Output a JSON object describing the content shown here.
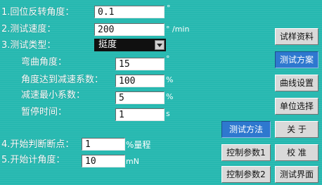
{
  "params": {
    "reverse_angle": {
      "label": "1.回位反转角度：",
      "value": "0.1",
      "unit": "°"
    },
    "test_speed": {
      "label": "2.测试速度：",
      "value": "200",
      "unit": "° /min"
    },
    "test_type": {
      "label": "3.测试类型：",
      "value": "挺度"
    },
    "bend_angle": {
      "label": "弯曲角度：",
      "value": "15",
      "unit": "°"
    },
    "angle_decel_coef": {
      "label": "角度达到减速系数：",
      "value": "100",
      "unit": "%"
    },
    "decel_min_coef": {
      "label": "减速最小系数：",
      "value": "5",
      "unit": "%"
    },
    "pause_time": {
      "label": "暂停时间：",
      "value": "1",
      "unit": "s"
    },
    "break_point": {
      "label": "4.开始判断断点：",
      "value": "1",
      "unit": "%量程"
    },
    "start_angle": {
      "label": "5.开始计角度：",
      "value": "10",
      "unit": "mN"
    }
  },
  "buttons": {
    "sample_data": "试样资料",
    "test_plan": "测试方案",
    "curve_settings": "曲线设置",
    "unit_select": "单位选择",
    "test_method": "测试方法",
    "about": "关 于",
    "control_param1": "控制参数1",
    "calibrate": "校 准",
    "control_param2": "控制参数2",
    "test_screen": "测试界面"
  },
  "colors": {
    "background": "#26b8b0",
    "active_button": "#2e78cf",
    "button": "#d9d9d9",
    "dropdown": "#101010"
  }
}
